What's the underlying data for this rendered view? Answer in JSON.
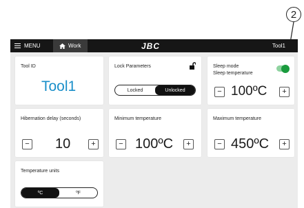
{
  "callout": {
    "number": "2"
  },
  "topbar": {
    "menu_label": "MENU",
    "work_tab_label": "Work",
    "logo_text": "JBC",
    "tool_title": "Tool1"
  },
  "cards": {
    "tool_id": {
      "title": "Tool ID",
      "value": "Tool1"
    },
    "lock": {
      "title": "Lock Parameters",
      "locked_label": "Locked",
      "unlocked_label": "Unlocked",
      "selected": "Unlocked"
    },
    "sleep": {
      "title": "Sleep mode",
      "subtitle": "Sleep temperature",
      "enabled": true,
      "value": "100ºC"
    },
    "hibernation": {
      "title": "Hibernation delay (seconds)",
      "value": "10"
    },
    "min_temp": {
      "title": "Minimum temperature",
      "value": "100ºC"
    },
    "max_temp": {
      "title": "Maximum temperature",
      "value": "450ºC"
    },
    "units": {
      "title": "Temperature units",
      "celsius_label": "ºC",
      "fahrenheit_label": "ºF",
      "selected": "ºC"
    }
  },
  "buttons": {
    "minus": "−",
    "plus": "+"
  },
  "colors": {
    "accent_toolid": "#1a8fc9",
    "toggle_on": "#1a9b3e",
    "topbar": "#161616"
  }
}
